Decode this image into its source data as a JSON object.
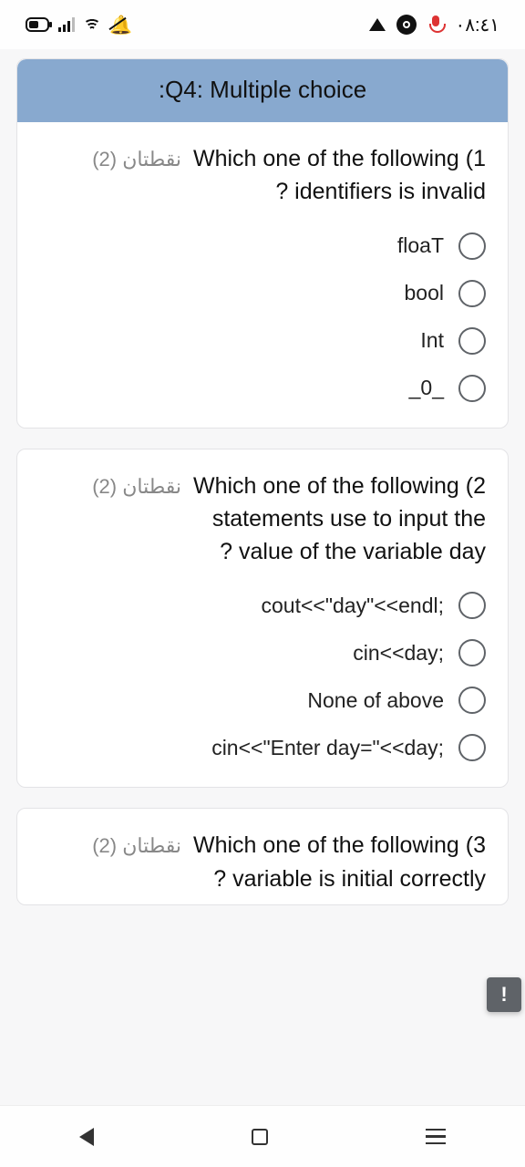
{
  "status": {
    "time": "٠٨:٤١"
  },
  "header": {
    "title": ":Q4: Multiple choice"
  },
  "q1": {
    "points": "نقطتان (2)",
    "line1": "Which one of the following (1",
    "line2": "? identifiers is invalid",
    "opts": [
      "floaT",
      "bool",
      "Int",
      "_0_"
    ]
  },
  "q2": {
    "points": "نقطتان (2)",
    "line1": "Which one of the following (2",
    "line2": "statements use to input the",
    "line3": "? value of the variable day",
    "opts": [
      "cout<<\"day\"<<endl;",
      "cin<<day;",
      "None of above",
      "cin<<\"Enter day=\"<<day;"
    ]
  },
  "q3": {
    "points": "نقطتان (2)",
    "line1": "Which one of the following (3",
    "line2": "? variable is initial correctly"
  },
  "report": {
    "label": "!"
  }
}
